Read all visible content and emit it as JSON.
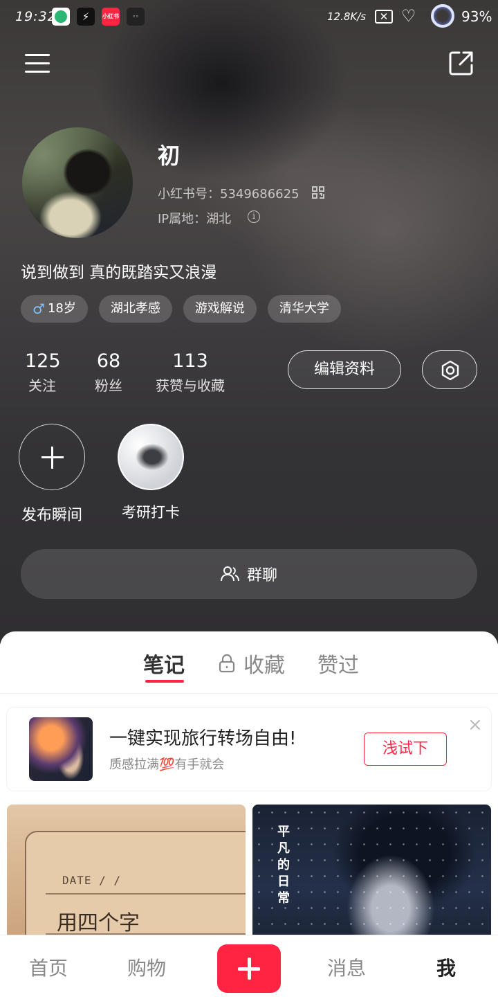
{
  "status_bar": {
    "time": "19:32",
    "apps": [
      "app-icon-green",
      "app-icon-bolt",
      "小红书",
      "app-icon-dark"
    ],
    "net_speed": "12.8K/s",
    "battery": "93%"
  },
  "profile": {
    "nickname": "初",
    "red_id_label": "小红书号：",
    "red_id": "5349686625",
    "ip_label": "IP属地：",
    "ip_location": "湖北",
    "bio": "说到做到 真的既踏实又浪漫",
    "tags": [
      {
        "icon": "male-icon",
        "label": "18岁"
      },
      {
        "label": "湖北孝感"
      },
      {
        "label": "游戏解说"
      },
      {
        "label": "清华大学"
      }
    ]
  },
  "stats": {
    "following": {
      "value": "125",
      "label": "关注"
    },
    "fans": {
      "value": "68",
      "label": "粉丝"
    },
    "likes": {
      "value": "113",
      "label": "获赞与收藏"
    }
  },
  "actions": {
    "edit_profile": "编辑资料",
    "settings_icon": "gear-icon"
  },
  "moments": {
    "publish_label": "发布瞬间",
    "study_label": "考研打卡"
  },
  "group_chat": {
    "label": "群聊",
    "icon": "users-icon"
  },
  "tabs": {
    "notes": "笔记",
    "favorites": "收藏",
    "liked": "赞过"
  },
  "ad": {
    "title": "一键实现旅行转场自由!",
    "subtitle": "质感拉满💯有手就会",
    "button": "浅试下",
    "close": "×"
  },
  "notes": {
    "left_card": {
      "date_text": "DATE  /  /",
      "handwriting": "用四个字"
    },
    "right_card": {
      "title": "平凡的日常"
    }
  },
  "bottom_nav": {
    "home": "首页",
    "shop": "购物",
    "messages": "消息",
    "me": "我"
  },
  "colors": {
    "accent": "#ff2442",
    "header_bg": "#3a3839"
  }
}
